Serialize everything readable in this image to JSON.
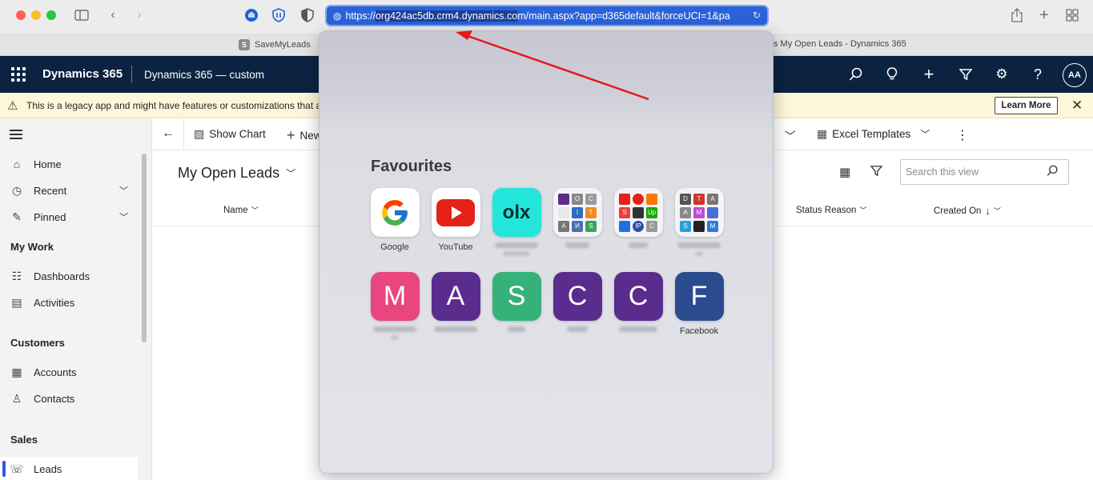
{
  "browser": {
    "url_prefix": "https://",
    "url_selected": "org424ac5db.crm4.dynamics.co",
    "url_rest": "m/main.aspx?app=d365default&forceUCI=1&pa",
    "tabs": [
      {
        "favicon": "S",
        "title": "SaveMyLeads"
      },
      {
        "title": "s My Open Leads - Dynamics 365"
      }
    ]
  },
  "nav": {
    "brand": "Dynamics 365",
    "app_name": "Dynamics 365 — custom",
    "avatar_initials": "AA"
  },
  "banner": {
    "text": "This is a legacy app and might have features or customizations that aren't",
    "learn_more": "Learn More"
  },
  "sidebar": {
    "items_top": [
      "Home",
      "Recent",
      "Pinned"
    ],
    "heading_mywork": "My Work",
    "items_mywork": [
      "Dashboards",
      "Activities"
    ],
    "heading_customers": "Customers",
    "items_customers": [
      "Accounts",
      "Contacts"
    ],
    "heading_sales": "Sales",
    "items_sales": [
      "Leads"
    ]
  },
  "commands": {
    "show_chart": "Show Chart",
    "new": "New",
    "excel_templates": "Excel Templates"
  },
  "view": {
    "title": "My Open Leads",
    "search_placeholder": "Search this view",
    "columns": [
      "Name",
      "Status Reason",
      "Created On"
    ]
  },
  "favourites": {
    "title": "Favourites",
    "row1": [
      {
        "label": "Google",
        "letter": "G"
      },
      {
        "label": "YouTube"
      },
      {
        "label": "",
        "letter": "olx"
      },
      {
        "label": ""
      },
      {
        "label": ""
      },
      {
        "label": ""
      }
    ],
    "row2": [
      {
        "letter": "M",
        "label": "",
        "color": "#e9457f"
      },
      {
        "letter": "A",
        "label": "",
        "color": "#5a2c8e"
      },
      {
        "letter": "S",
        "label": "",
        "color": "#35b27a"
      },
      {
        "letter": "C",
        "label": "",
        "color": "#5a2c8e"
      },
      {
        "letter": "C",
        "label": "",
        "color": "#5a2c8e"
      },
      {
        "letter": "F",
        "label": "Facebook",
        "color": "#2b4b8f"
      }
    ],
    "grid_a": [
      "",
      "O",
      "C",
      "",
      "I",
      "T",
      "A",
      "И",
      "S"
    ],
    "grid_b": [
      "",
      "",
      "",
      "S",
      "",
      "Up",
      "",
      "IP",
      "C"
    ],
    "grid_c": [
      "D",
      "T",
      "A",
      "A",
      "M",
      "",
      "S",
      "",
      "M"
    ]
  }
}
